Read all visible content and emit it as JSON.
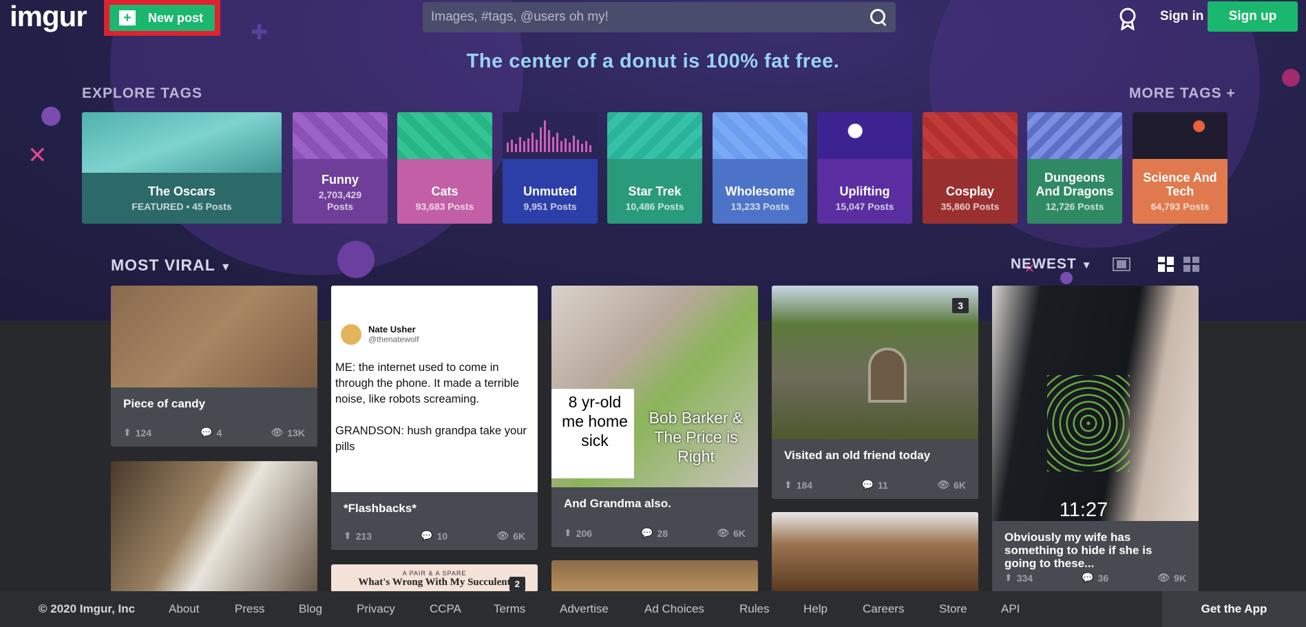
{
  "header": {
    "logo": "imgur",
    "new_post": "New post",
    "search_placeholder": "Images, #tags, @users oh my!",
    "sign_in": "Sign in",
    "sign_up": "Sign up"
  },
  "tagline": "The center of a donut is 100% fat free.",
  "explore": {
    "title": "EXPLORE TAGS",
    "more": "MORE TAGS +",
    "tags": [
      {
        "name": "The Oscars",
        "count": "FEATURED • 45 Posts",
        "color": "#2b6a69"
      },
      {
        "name": "Funny",
        "count": "2,703,429 Posts",
        "color": "#6f3e98"
      },
      {
        "name": "Cats",
        "count": "93,683 Posts",
        "color": "#c35fa6"
      },
      {
        "name": "Unmuted",
        "count": "9,951 Posts",
        "color": "#2c3fa8"
      },
      {
        "name": "Star Trek",
        "count": "10,486 Posts",
        "color": "#2a9a7c"
      },
      {
        "name": "Wholesome",
        "count": "13,233 Posts",
        "color": "#4d73c9"
      },
      {
        "name": "Uplifting",
        "count": "15,047 Posts",
        "color": "#5a2ea0"
      },
      {
        "name": "Cosplay",
        "count": "35,860 Posts",
        "color": "#9a2f2f"
      },
      {
        "name": "Dungeons And Dragons",
        "count": "12,726 Posts",
        "color": "#2f8a63"
      },
      {
        "name": "Science And Tech",
        "count": "64,793 Posts",
        "color": "#e07a4e"
      }
    ]
  },
  "feed": {
    "sort": "MOST VIRAL",
    "order": "NEWEST",
    "posts": [
      {
        "title": "Piece of candy",
        "ups": "124",
        "comments": "4",
        "views": "13K"
      },
      {
        "title": "*Flashbacks*",
        "ups": "213",
        "comments": "10",
        "views": "6K"
      },
      {
        "title": "And Grandma also.",
        "ups": "206",
        "comments": "28",
        "views": "6K"
      },
      {
        "title": "Visited an old friend today",
        "ups": "184",
        "comments": "11",
        "views": "6K",
        "badge": "3"
      },
      {
        "title": "Obviously my wife has something to hide if she is going to these...",
        "ups": "334",
        "comments": "36",
        "views": "9K"
      }
    ],
    "tweet": {
      "name": "Nate Usher",
      "handle": "@thenatewolf",
      "text": "ME: the internet used to come in through the phone. It made a terrible noise, like robots screaming.\n\nGRANDSON: hush grandpa take your pills"
    },
    "meme_left": "8 yr-old me home sick",
    "meme_right": "Bob Barker & The Price is Right",
    "phone_time": "11:27",
    "succulent_kicker": "A PAIR & A SPARE",
    "succulent_title": "What's Wrong With My Succulent",
    "succulent_badge": "2"
  },
  "footer": {
    "copyright": "© 2020 Imgur, Inc",
    "links": [
      "About",
      "Press",
      "Blog",
      "Privacy",
      "CCPA",
      "Terms",
      "Advertise",
      "Ad Choices",
      "Rules",
      "Help",
      "Careers",
      "Store",
      "API"
    ],
    "get_app": "Get the App"
  }
}
